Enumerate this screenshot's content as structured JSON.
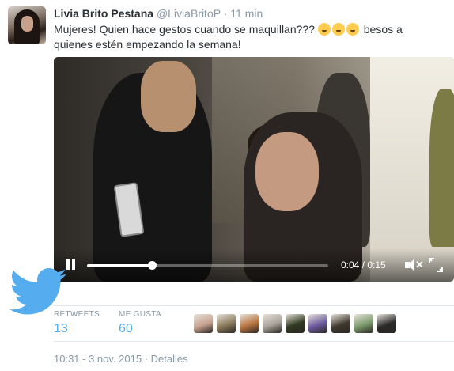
{
  "tweet": {
    "author_name": "Livia Brito Pestana",
    "handle": "@LiviaBritoP",
    "separator": "·",
    "time_ago": "11 min",
    "text_line1": "Mujeres! Quien hace gestos cuando se maquillan???",
    "text_line1_end": "besos a",
    "text_line2": "quienes estén empezando la semana!"
  },
  "video": {
    "progress": 0.27,
    "time_display": "0:04 / 0:15"
  },
  "stats": {
    "retweets_label": "RETWEETS",
    "retweets_count": "13",
    "likes_label": "ME GUSTA",
    "likes_count": "60"
  },
  "likers": [
    {
      "color": "#c7a28f"
    },
    {
      "color": "#8a7a5a"
    },
    {
      "color": "#b8743e"
    },
    {
      "color": "#a9a29a"
    },
    {
      "color": "#2f3a22"
    },
    {
      "color": "#6a5a9e"
    },
    {
      "color": "#3e3a30"
    },
    {
      "color": "#7a9a6a"
    },
    {
      "color": "#2a2a2a"
    }
  ],
  "footer": {
    "timestamp": "10:31 - 3 nov. 2015",
    "separator": "·",
    "details_label": "Detalles"
  },
  "colors": {
    "twitter_blue": "#55acee",
    "muted_gray": "#8899a6",
    "text_dark": "#292f33"
  },
  "icons": {
    "emojis": [
      "hushed-face-emoji",
      "kissing-face-emoji",
      "face-blowing-kiss-emoji"
    ],
    "bird": "twitter-bird-icon"
  }
}
